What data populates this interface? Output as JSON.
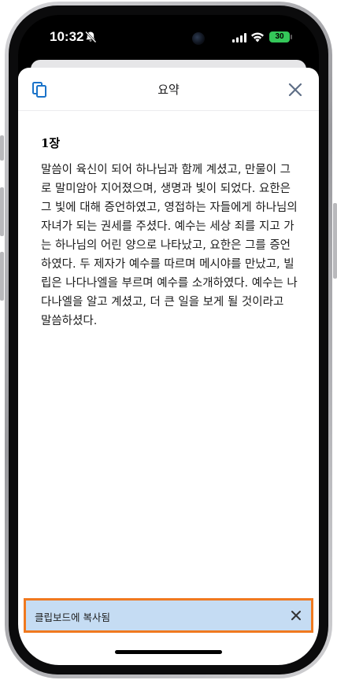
{
  "status_bar": {
    "time": "10:32",
    "battery": "30",
    "icons": [
      "bell-slash-icon",
      "cellular-signal-icon",
      "wifi-icon",
      "battery-charging-icon"
    ]
  },
  "sheet": {
    "title": "요약",
    "copy_icon": "copy-icon",
    "close_icon": "close-icon"
  },
  "content": {
    "chapter": "1장",
    "summary": "말씀이 육신이 되어 하나님과 함께 계셨고, 만물이 그로 말미암아 지어졌으며, 생명과 빛이 되었다. 요한은 그 빛에 대해 증언하였고, 영접하는 자들에게 하나님의 자녀가 되는 권세를 주셨다. 예수는 세상 죄를 지고 가는 하나님의 어린 양으로 나타났고, 요한은 그를 증언하였다. 두 제자가 예수를 따르며 메시야를 만났고, 빌립은 나다나엘을 부르며 예수를 소개하였다. 예수는 나다나엘을 알고 계셨고, 더 큰 일을 보게 될 것이라고 말씀하셨다."
  },
  "toast": {
    "message": "클립보드에 복사됨",
    "close_icon": "close-icon"
  },
  "colors": {
    "accent": "#1a73c9",
    "toast_background": "#c5dcf3",
    "toast_highlight_border": "#f0791f",
    "battery": "#34c759"
  }
}
